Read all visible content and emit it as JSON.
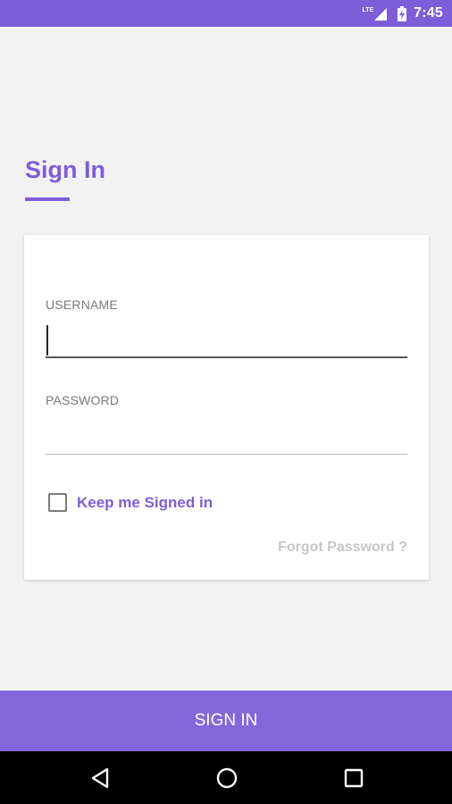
{
  "status_bar": {
    "network_label": "LTE",
    "time": "7:45",
    "icons": [
      "lte-signal-icon",
      "battery-charging-icon"
    ]
  },
  "page": {
    "title": "Sign In"
  },
  "form": {
    "username": {
      "label": "USERNAME",
      "value": "",
      "placeholder": ""
    },
    "password": {
      "label": "PASSWORD",
      "value": "",
      "placeholder": ""
    },
    "keep_signed_in": {
      "label": "Keep me Signed in",
      "checked": false
    },
    "forgot_password_label": "Forgot Password ?"
  },
  "actions": {
    "sign_in_label": "SIGN IN"
  },
  "nav_bar": {
    "icons": [
      "back-icon",
      "home-icon",
      "recents-icon"
    ]
  },
  "colors": {
    "accent": "#7e5dd8",
    "button": "#8367da",
    "background": "#f2f2f2",
    "card": "#ffffff",
    "link_muted": "#c7c7c7"
  }
}
